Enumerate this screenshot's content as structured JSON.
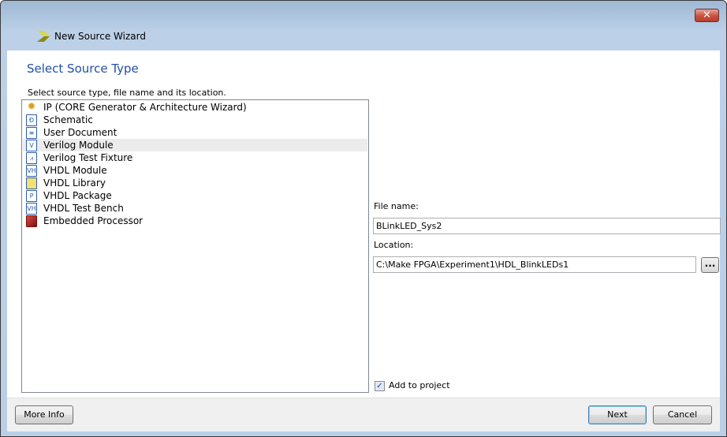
{
  "window": {
    "title": "New Source Wizard",
    "close_label": "✕"
  },
  "page": {
    "heading": "Select Source Type",
    "instruction": "Select source type, file name and its location."
  },
  "source_types": [
    {
      "label": "IP (CORE Generator & Architecture Wizard)",
      "icon": "ip-bulb-icon",
      "glyph": "✹"
    },
    {
      "label": "Schematic",
      "icon": "schematic-icon",
      "glyph": "Ð"
    },
    {
      "label": "User Document",
      "icon": "document-icon",
      "glyph": "≡"
    },
    {
      "label": "Verilog Module",
      "icon": "verilog-module-icon",
      "glyph": "V",
      "selected": true
    },
    {
      "label": "Verilog Test Fixture",
      "icon": "verilog-test-fixture-icon",
      "glyph": "⩘"
    },
    {
      "label": "VHDL Module",
      "icon": "vhdl-module-icon",
      "glyph": "VH"
    },
    {
      "label": "VHDL Library",
      "icon": "vhdl-library-icon",
      "glyph": ""
    },
    {
      "label": "VHDL Package",
      "icon": "vhdl-package-icon",
      "glyph": "P"
    },
    {
      "label": "VHDL Test Bench",
      "icon": "vhdl-test-bench-icon",
      "glyph": "VH"
    },
    {
      "label": "Embedded Processor",
      "icon": "embedded-processor-icon",
      "glyph": ""
    }
  ],
  "form": {
    "file_name_label": "File name:",
    "file_name_value": "BLinkLED_Sys2",
    "location_label": "Location:",
    "location_value": "C:\\Make FPGA\\Experiment1\\HDL_BlinkLEDs1",
    "browse_label": "...",
    "add_to_project_label": "Add to project",
    "add_to_project_checked": true,
    "check_glyph": "✓"
  },
  "footer": {
    "more_info": "More Info",
    "next": "Next",
    "cancel": "Cancel"
  }
}
